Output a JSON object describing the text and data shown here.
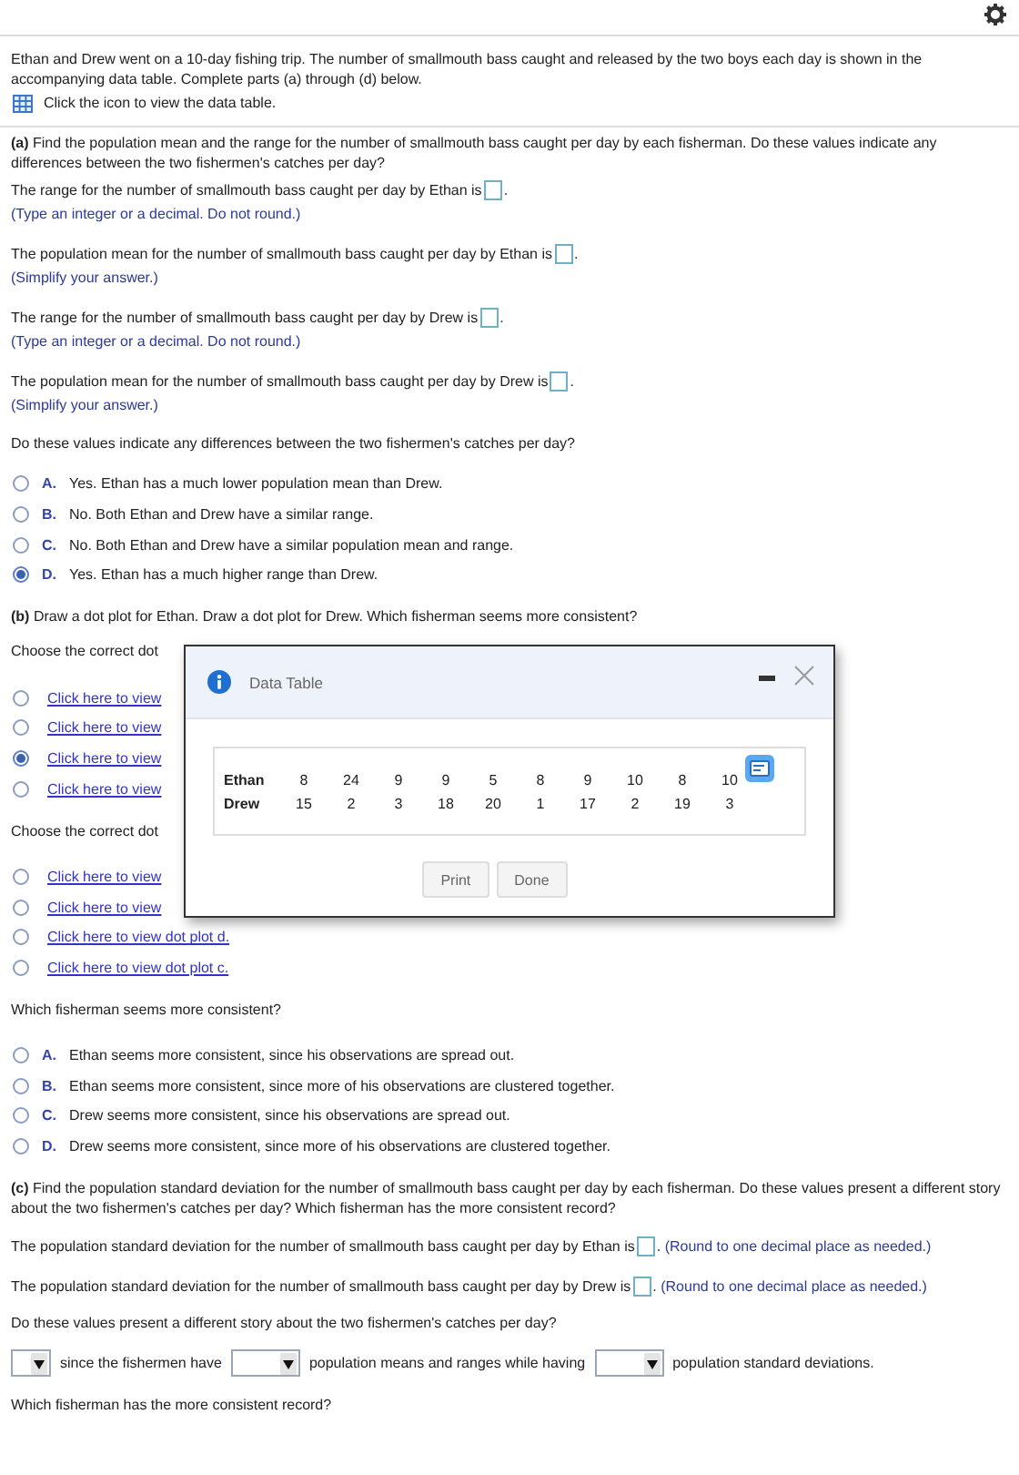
{
  "intro": {
    "text": "Ethan and Drew went on a 10-day fishing trip. The number of smallmouth bass caught and released by the two boys each day is shown in the accompanying data table. Complete parts (a) through (d) below.",
    "table_link": "Click the icon to view the data table."
  },
  "part_a": {
    "prompt": "**(a)** Find the population mean and the range for the number of smallmouth bass caught per day by each fisherman. Do these values indicate any differences between the two fishermen's catches per day?",
    "answers": [
      {
        "text": "The range for the number of smallmouth bass caught per day by Ethan is",
        "after": ".",
        "hint": "(Type an integer or a decimal. Do not round.)"
      },
      {
        "text": "The population mean for the number of smallmouth bass caught per day by Ethan is",
        "after": ".",
        "hint": "(Simplify your answer.)"
      },
      {
        "text": "The range for the number of smallmouth bass caught per day by Drew is",
        "after": ".",
        "hint": "(Type an integer or a decimal. Do not round.)"
      },
      {
        "text": "The population mean for the number of smallmouth bass caught per day by Drew is",
        "after": ".",
        "hint": "(Simplify your answer.)"
      }
    ],
    "question": "Do these values indicate any differences between the two fishermen's catches per day?",
    "choices": [
      {
        "letter": "A.",
        "text": "Yes. Ethan has a much lower population mean than Drew.",
        "selected": false
      },
      {
        "letter": "B.",
        "text": "No. Both Ethan and Drew have a similar range.",
        "selected": false
      },
      {
        "letter": "C.",
        "text": "No. Both Ethan and Drew have a similar population mean and range.",
        "selected": false
      },
      {
        "letter": "D.",
        "text": "Yes. Ethan has a much higher range than Drew.",
        "selected": true
      }
    ]
  },
  "part_b": {
    "prompt": "**(b)** Draw a dot plot for Ethan. Draw a dot plot for Drew. Which fisherman seems more consistent?",
    "groups": [
      {
        "instruction": "Choose the correct dot",
        "options": [
          {
            "label": "Click here to view",
            "selected": false
          },
          {
            "label": "Click here to view",
            "selected": false
          },
          {
            "label": "Click here to view",
            "selected": true
          },
          {
            "label": "Click here to view",
            "selected": false
          }
        ]
      },
      {
        "instruction": "Choose the correct dot",
        "options": [
          {
            "label": "Click here to view",
            "selected": false
          },
          {
            "label": "Click here to view",
            "selected": false
          },
          {
            "label": "Click here to view dot plot d.",
            "selected": false
          },
          {
            "label": "Click here to view dot plot c.",
            "selected": false
          }
        ]
      }
    ],
    "question": "Which fisherman seems more consistent?",
    "choices": [
      {
        "letter": "A.",
        "text": "Ethan seems more consistent, since his observations are spread out.",
        "selected": false
      },
      {
        "letter": "B.",
        "text": "Ethan seems more consistent, since more of his observations are clustered together.",
        "selected": false
      },
      {
        "letter": "C.",
        "text": "Drew seems more consistent, since his observations are spread out.",
        "selected": false
      },
      {
        "letter": "D.",
        "text": "Drew seems more consistent, since more of his observations are clustered together.",
        "selected": false
      }
    ]
  },
  "part_c": {
    "prompt": "**(c)** Find the population standard deviation for the number of smallmouth bass caught per day by each fisherman. Do these values present a different story about the two fishermen's catches per day? Which fisherman has the more consistent record?",
    "answers": [
      {
        "text": "The population standard deviation for the number of smallmouth bass caught per day by Ethan is",
        "after": ".",
        "hint": "(Round to one decimal place as needed.)"
      },
      {
        "text": "The population standard deviation for the number of smallmouth bass caught per day by Drew is",
        "after": ".",
        "hint": "(Round to one decimal place as needed.)"
      }
    ],
    "question": "Do these values present a different story about the two fishermen's catches per day?",
    "sentence": [
      {
        "kind": "dropdown"
      },
      {
        "kind": "text",
        "text": "since the fishermen have"
      },
      {
        "kind": "dropdown"
      },
      {
        "kind": "text",
        "text": "population means and ranges while having"
      },
      {
        "kind": "dropdown"
      },
      {
        "kind": "text",
        "text": "population standard deviations."
      }
    ],
    "final_question": "Which fisherman has the more consistent record?"
  },
  "dialog": {
    "title": "Data Table",
    "rows": [
      {
        "name": "Ethan",
        "values": [
          "8",
          "24",
          "9",
          "9",
          "5",
          "8",
          "9",
          "10",
          "8",
          "10"
        ]
      },
      {
        "name": "Drew",
        "values": [
          "15",
          "2",
          "3",
          "18",
          "20",
          "1",
          "17",
          "2",
          "19",
          "3"
        ]
      }
    ],
    "buttons": [
      "Print",
      "Done"
    ]
  }
}
